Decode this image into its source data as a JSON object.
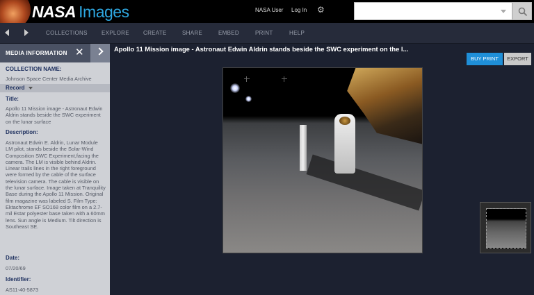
{
  "header": {
    "logo_nasa": "NASA",
    "logo_images": "Images",
    "user_link": "NASA User",
    "login_link": "Log In",
    "search_placeholder": ""
  },
  "nav": {
    "items": [
      "COLLECTIONS",
      "EXPLORE",
      "CREATE",
      "SHARE",
      "EMBED",
      "PRINT",
      "HELP"
    ]
  },
  "sidebar": {
    "title": "MEDIA INFORMATION",
    "collection_label": "COLLECTION NAME:",
    "collection_value": "Johnson Space Center Media Archive",
    "record_label": "Record",
    "title_label": "Title:",
    "title_value": "Apollo 11 Mission image - Astronaut Edwin Aldrin stands beside the SWC experiment on the lunar surface",
    "description_label": "Description:",
    "description_value": "Astronaut Edwin E. Aldrin, Lunar Module LM pilot, stands beside the Solar-Wind Composition SWC Experiment,facing the camera. The LM is visible behind Aldrin. Linear trails lines in the right foreground were formed by the cable of the surface television camera. The cable is visible on the lunar surface. Image taken at Tranquility Base during the Apollo 11 Mission. Original film magazine was labeled S. Film Type: Ektachrome EF SO168 color film on a 2.7-mil Estar polyester base taken with a 60mm lens. Sun angle is Medium. Tilt direction is Southeast SE.",
    "date_label": "Date:",
    "date_value": "07/20/69",
    "identifier_label": "Identifier:",
    "identifier_value": "AS11-40-5873"
  },
  "main": {
    "title": "Apollo 11 Mission image - Astronaut Edwin Aldrin stands beside the SWC experiment on the l...",
    "buy_print": "BUY PRINT",
    "export": "EXPORT"
  },
  "colors": {
    "accent_blue": "#1f8fd8",
    "logo_blue": "#2ea7e0",
    "label_navy": "#1d2f5e"
  }
}
